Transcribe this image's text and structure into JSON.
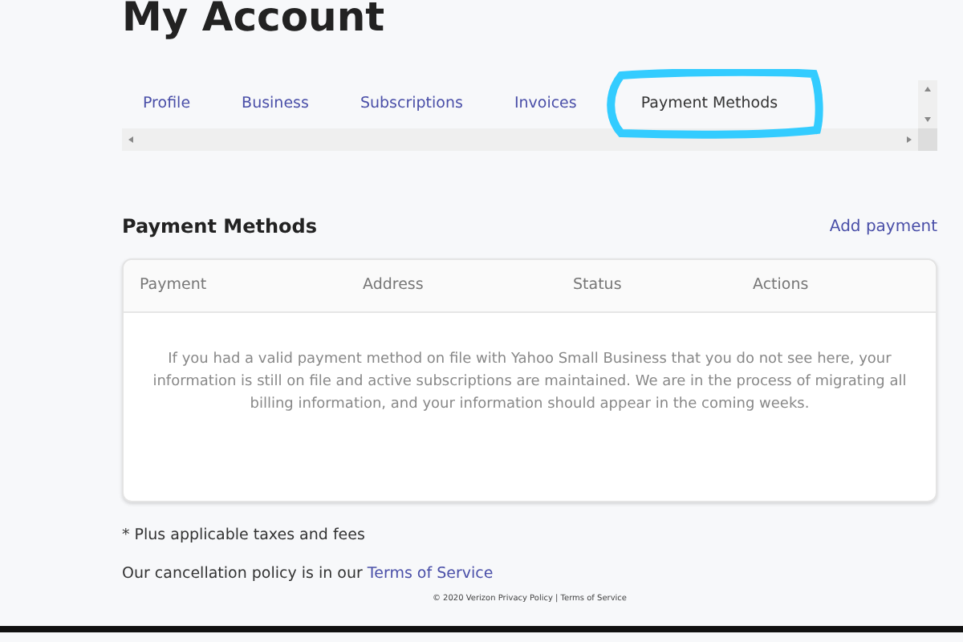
{
  "page": {
    "title": "My Account"
  },
  "tabs": [
    {
      "label": "Profile",
      "selected": false
    },
    {
      "label": "Business",
      "selected": false
    },
    {
      "label": "Subscriptions",
      "selected": false
    },
    {
      "label": "Invoices",
      "selected": false
    },
    {
      "label": "Payment Methods",
      "selected": true,
      "highlighted": true
    }
  ],
  "section": {
    "title": "Payment Methods",
    "action": "Add payment"
  },
  "table": {
    "columns": [
      "Payment",
      "Address",
      "Status",
      "Actions"
    ],
    "empty_message": "If you had a valid payment method on file with Yahoo Small Business that you do not see here, your information is still on file and active subscriptions are maintained. We are in the process of migrating all billing information, and your information should appear in the coming weeks."
  },
  "notes": {
    "taxes": "* Plus applicable taxes and fees",
    "cancellation": "Our cancellation policy is in our",
    "cancellation_link": "Terms of Service"
  },
  "footer": "© 2020 Verizon Privacy Policy | Terms of Service"
}
